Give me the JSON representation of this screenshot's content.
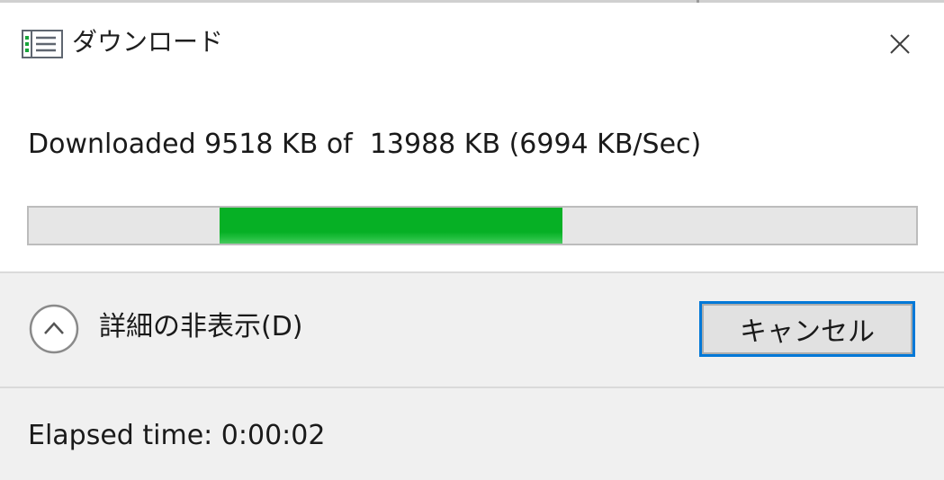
{
  "window": {
    "title": "ダウンロード",
    "icon": "download-list-icon",
    "close_icon": "close-icon"
  },
  "status": {
    "text": "Downloaded 9518 KB of  13988 KB (6994 KB/Sec)",
    "downloaded_kb": 9518,
    "total_kb": 13988,
    "speed_kb_per_sec": 6994
  },
  "progress": {
    "indeterminate_segment_start": 0.215,
    "indeterminate_segment_end": 0.601,
    "fill_color": "#06b025",
    "track_color": "#e6e6e6"
  },
  "details": {
    "toggle_label": "詳細の非表示(D)",
    "toggle_icon": "chevron-up-icon"
  },
  "actions": {
    "cancel_label": "キャンセル",
    "focus_color": "#0078d7"
  },
  "footer": {
    "elapsed_label": "Elapsed time: 0:00:02"
  }
}
